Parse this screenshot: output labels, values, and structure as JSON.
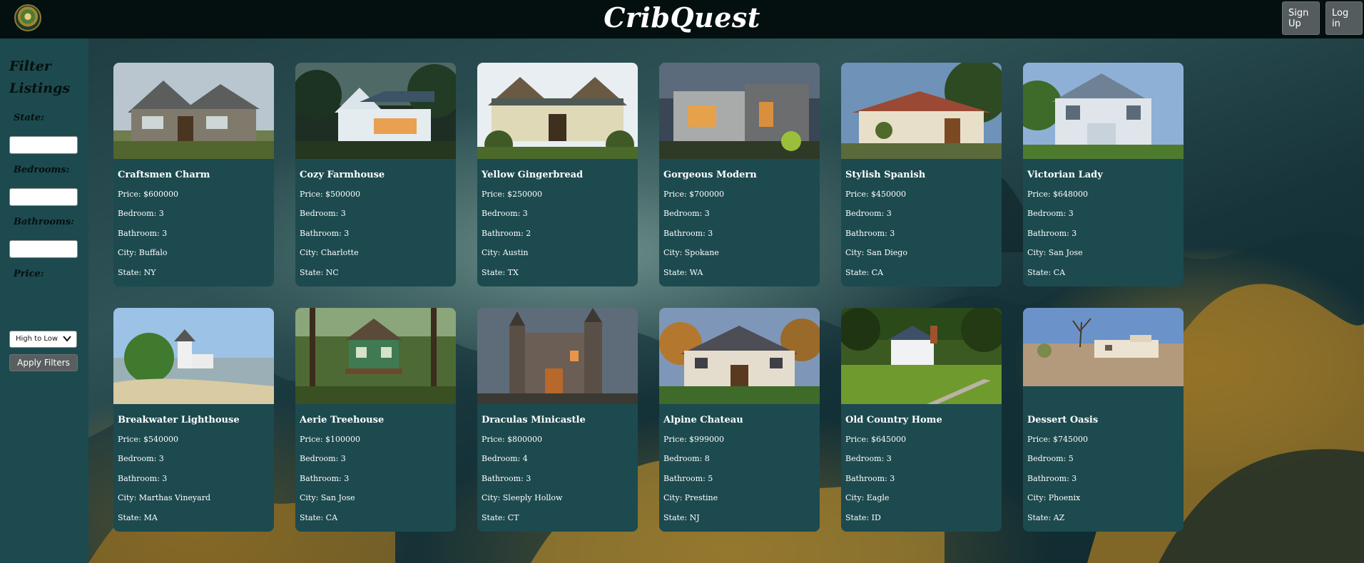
{
  "header": {
    "brand": "CribQuest",
    "signup_label": "Sign Up",
    "login_label": "Log in"
  },
  "sidebar": {
    "title": "Filter Listings",
    "state_label": "State:",
    "bedrooms_label": "Bedrooms:",
    "bathrooms_label": "Bathrooms:",
    "price_label": "Price:",
    "price_sort_selected": "High to Low",
    "apply_label": "Apply Filters"
  },
  "listings": [
    {
      "title": "Craftsmen Charm",
      "price": "Price: $600000",
      "bedroom": "Bedroom: 3",
      "bathroom": "Bathroom: 3",
      "city": "City: Buffalo",
      "state": "State: NY"
    },
    {
      "title": "Cozy Farmhouse",
      "price": "Price: $500000",
      "bedroom": "Bedroom: 3",
      "bathroom": "Bathroom: 3",
      "city": "City: Charlotte",
      "state": "State: NC"
    },
    {
      "title": "Yellow Gingerbread",
      "price": "Price: $250000",
      "bedroom": "Bedroom: 3",
      "bathroom": "Bathroom: 2",
      "city": "City: Austin",
      "state": "State: TX"
    },
    {
      "title": "Gorgeous Modern",
      "price": "Price: $700000",
      "bedroom": "Bedroom: 3",
      "bathroom": "Bathroom: 3",
      "city": "City: Spokane",
      "state": "State: WA"
    },
    {
      "title": "Stylish Spanish",
      "price": "Price: $450000",
      "bedroom": "Bedroom: 3",
      "bathroom": "Bathroom: 3",
      "city": "City: San Diego",
      "state": "State: CA"
    },
    {
      "title": "Victorian Lady",
      "price": "Price: $648000",
      "bedroom": "Bedroom: 3",
      "bathroom": "Bathroom: 3",
      "city": "City: San Jose",
      "state": "State: CA"
    },
    {
      "title": "Breakwater Lighthouse",
      "price": "Price: $540000",
      "bedroom": "Bedroom: 3",
      "bathroom": "Bathroom: 3",
      "city": "City: Marthas Vineyard",
      "state": "State: MA"
    },
    {
      "title": "Aerie Treehouse",
      "price": "Price: $100000",
      "bedroom": "Bedroom: 3",
      "bathroom": "Bathroom: 3",
      "city": "City: San Jose",
      "state": "State: CA"
    },
    {
      "title": "Draculas Minicastle",
      "price": "Price: $800000",
      "bedroom": "Bedroom: 4",
      "bathroom": "Bathroom: 3",
      "city": "City: Sleeply Hollow",
      "state": "State: CT"
    },
    {
      "title": "Alpine Chateau",
      "price": "Price: $999000",
      "bedroom": "Bedroom: 8",
      "bathroom": "Bathroom: 5",
      "city": "City: Prestine",
      "state": "State: NJ"
    },
    {
      "title": "Old Country Home",
      "price": "Price: $645000",
      "bedroom": "Bedroom: 3",
      "bathroom": "Bathroom: 3",
      "city": "City: Eagle",
      "state": "State: ID"
    },
    {
      "title": "Dessert Oasis",
      "price": "Price: $745000",
      "bedroom": "Bedroom: 5",
      "bathroom": "Bathroom: 3",
      "city": "City: Phoenix",
      "state": "State: AZ"
    }
  ]
}
